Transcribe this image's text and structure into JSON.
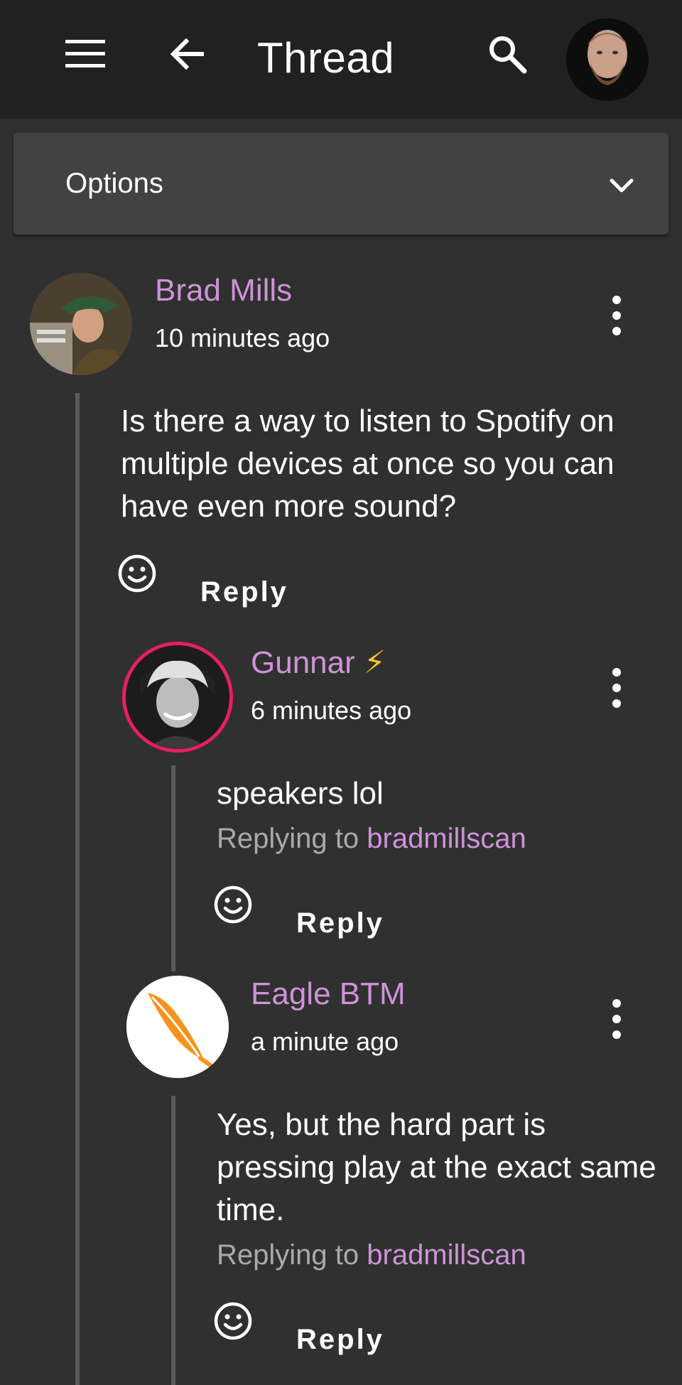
{
  "header": {
    "title": "Thread",
    "menu_icon": "menu-icon",
    "back_icon": "arrow-back-icon",
    "search_icon": "search-icon"
  },
  "options": {
    "label": "Options",
    "icon": "chevron-down-icon"
  },
  "colors": {
    "background": "#303030",
    "appbar": "#212121",
    "panel": "#424242",
    "username": "#ce93d8",
    "muted": "#aaaaaa",
    "thread_line": "#5a5a5a",
    "avatar_ring": "#e91e63"
  },
  "comments": [
    {
      "author": "Brad Mills",
      "time": "10 minutes ago",
      "body": "Is there a way to listen to Spotify on multiple devices at once so you can have even more sound?",
      "reply_label": "Reply"
    },
    {
      "author": "Gunnar",
      "badge": "⚡",
      "time": "6 minutes ago",
      "body": "speakers lol",
      "replying_prefix": "Replying to",
      "replying_handle": "bradmillscan",
      "reply_label": "Reply"
    },
    {
      "author": "Eagle BTM",
      "time": "a minute ago",
      "body": "Yes, but the hard part is pressing play at the exact same time.",
      "replying_prefix": "Replying to",
      "replying_handle": "bradmillscan",
      "reply_label": "Reply"
    }
  ]
}
